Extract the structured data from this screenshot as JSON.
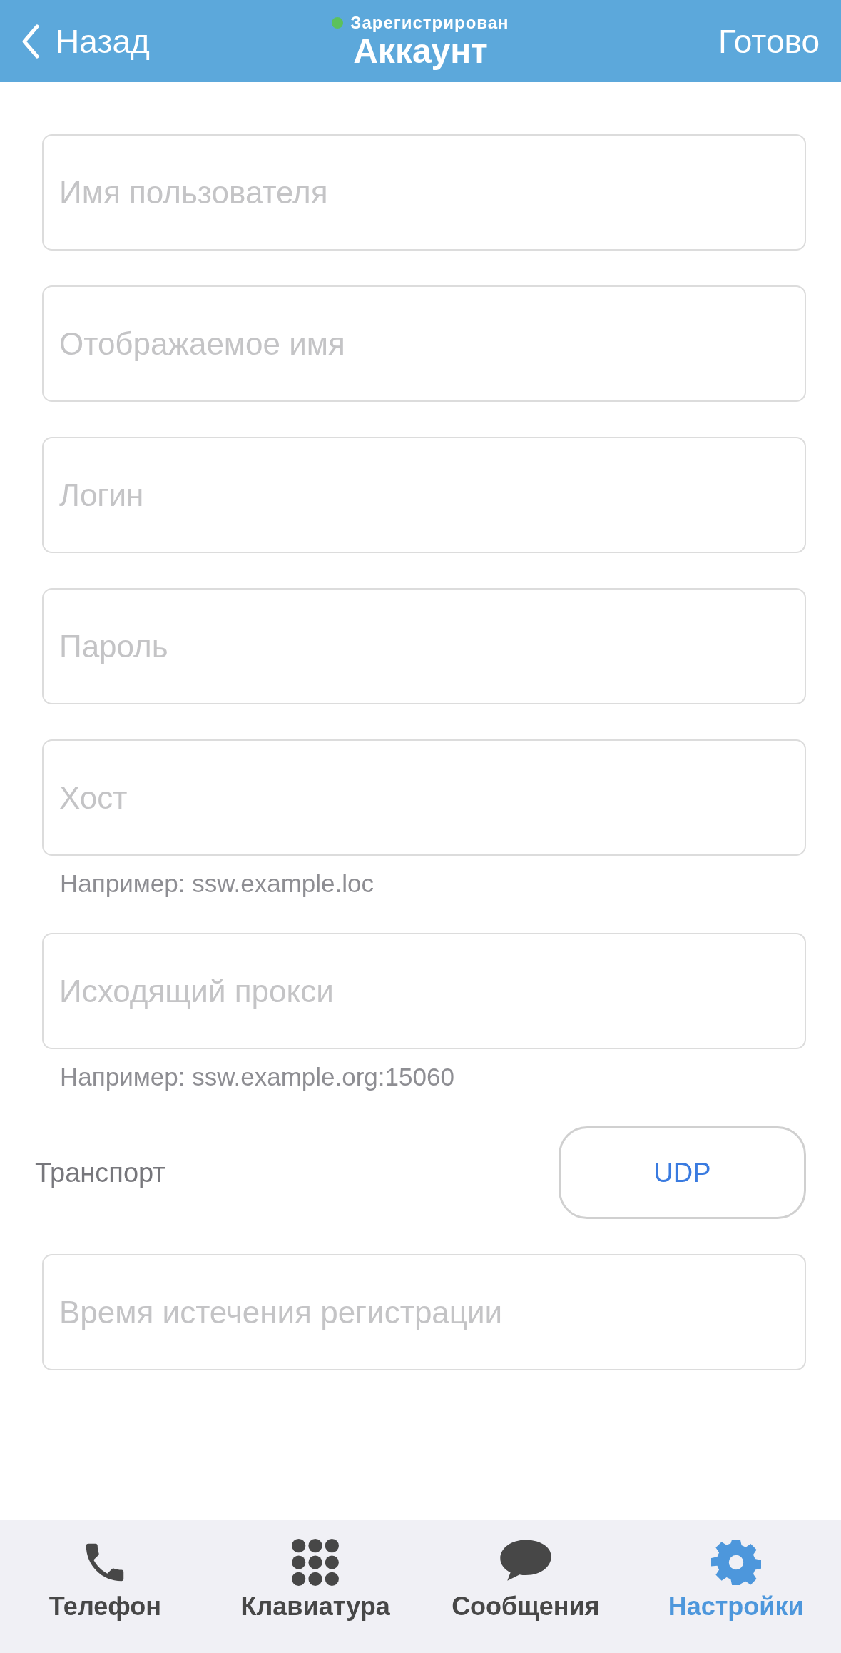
{
  "header": {
    "back": "Назад",
    "status": {
      "text": "Зарегистрирован",
      "color": "#5cc15c"
    },
    "title": "Аккаунт",
    "done": "Готово"
  },
  "form": [
    {
      "kind": "field",
      "placeholder": "Имя пользователя"
    },
    {
      "kind": "field",
      "placeholder": "Отображаемое имя"
    },
    {
      "kind": "field",
      "placeholder": "Логин"
    },
    {
      "kind": "field",
      "placeholder": "Пароль"
    },
    {
      "kind": "field",
      "placeholder": "Хост",
      "hint": "Например: ssw.example.loc"
    },
    {
      "kind": "field",
      "placeholder": "Исходящий прокси",
      "hint": "Например: ssw.example.org:15060"
    },
    {
      "kind": "select",
      "label": "Транспорт",
      "value": "UDP"
    },
    {
      "kind": "field",
      "placeholder": "Время истечения регистрации"
    }
  ],
  "tab_bar": [
    {
      "label": "Телефон",
      "kind": "phone",
      "selected": false
    },
    {
      "label": "Клавиатура",
      "kind": "keypad",
      "selected": false
    },
    {
      "label": "Сообщения",
      "kind": "chat",
      "selected": false
    },
    {
      "label": "Настройки",
      "kind": "gear",
      "selected": true
    }
  ]
}
